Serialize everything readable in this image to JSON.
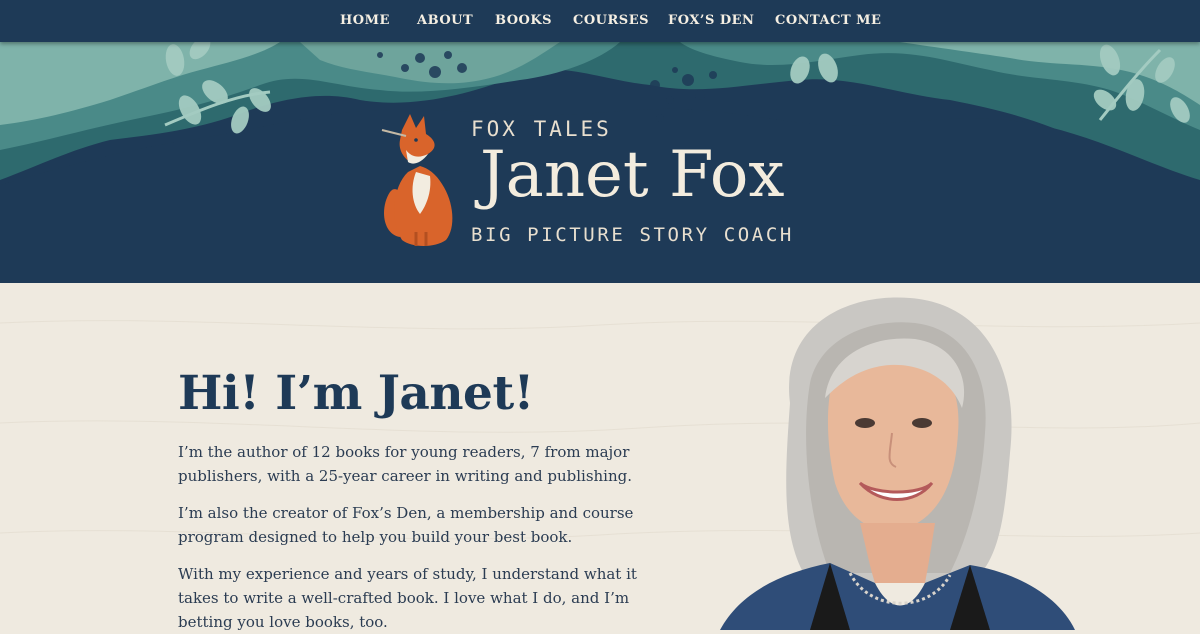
{
  "nav": {
    "items": [
      "HOME",
      "ABOUT",
      "BOOKS",
      "COURSES",
      "FOX’S DEN",
      "CONTACT ME"
    ]
  },
  "brand": {
    "kicker": "FOX TALES",
    "name": "Janet Fox",
    "tagline": "BIG PICTURE STORY COACH",
    "icon": "fox-logo-icon"
  },
  "intro": {
    "heading": "Hi! I’m Janet!",
    "paragraphs": [
      "I’m the author of 12 books for young readers, 7 from major publishers, with a 25-year career in writing and publishing.",
      "I’m also the creator of Fox’s Den, a membership and course program designed to help you build your best book.",
      "With my experience and years of study, I understand what it takes to write a well-crafted book. I love what I do, and I’m betting you love books, too."
    ]
  },
  "colors": {
    "navy": "#1e3a57",
    "teal": "#5f9c95",
    "cream": "#efeae0",
    "fox_orange": "#d9642b"
  }
}
